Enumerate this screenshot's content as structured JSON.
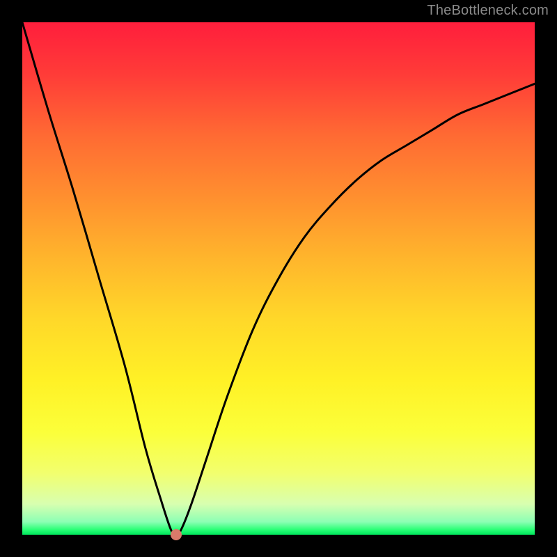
{
  "watermark": {
    "text": "TheBottleneck.com"
  },
  "chart_data": {
    "type": "line",
    "title": "",
    "xlabel": "",
    "ylabel": "",
    "xlim": [
      0,
      100
    ],
    "ylim": [
      0,
      100
    ],
    "grid": false,
    "series": [
      {
        "name": "bottleneck-curve",
        "x": [
          0,
          5,
          10,
          15,
          20,
          24,
          27,
          29,
          30,
          31,
          33,
          36,
          40,
          45,
          50,
          55,
          60,
          65,
          70,
          75,
          80,
          85,
          90,
          95,
          100
        ],
        "values": [
          100,
          83,
          67,
          50,
          33,
          17,
          7,
          1,
          0,
          1,
          6,
          15,
          27,
          40,
          50,
          58,
          64,
          69,
          73,
          76,
          79,
          82,
          84,
          86,
          88
        ]
      }
    ],
    "marker": {
      "x": 30,
      "y": 0,
      "color": "#d87a6a"
    },
    "background_gradient": {
      "direction": "vertical",
      "stops": [
        {
          "pos": 0.0,
          "color": "#ff1e3c"
        },
        {
          "pos": 0.5,
          "color": "#ffc828"
        },
        {
          "pos": 0.8,
          "color": "#fbff3a"
        },
        {
          "pos": 0.97,
          "color": "#8cffb4"
        },
        {
          "pos": 1.0,
          "color": "#00e65c"
        }
      ]
    }
  }
}
